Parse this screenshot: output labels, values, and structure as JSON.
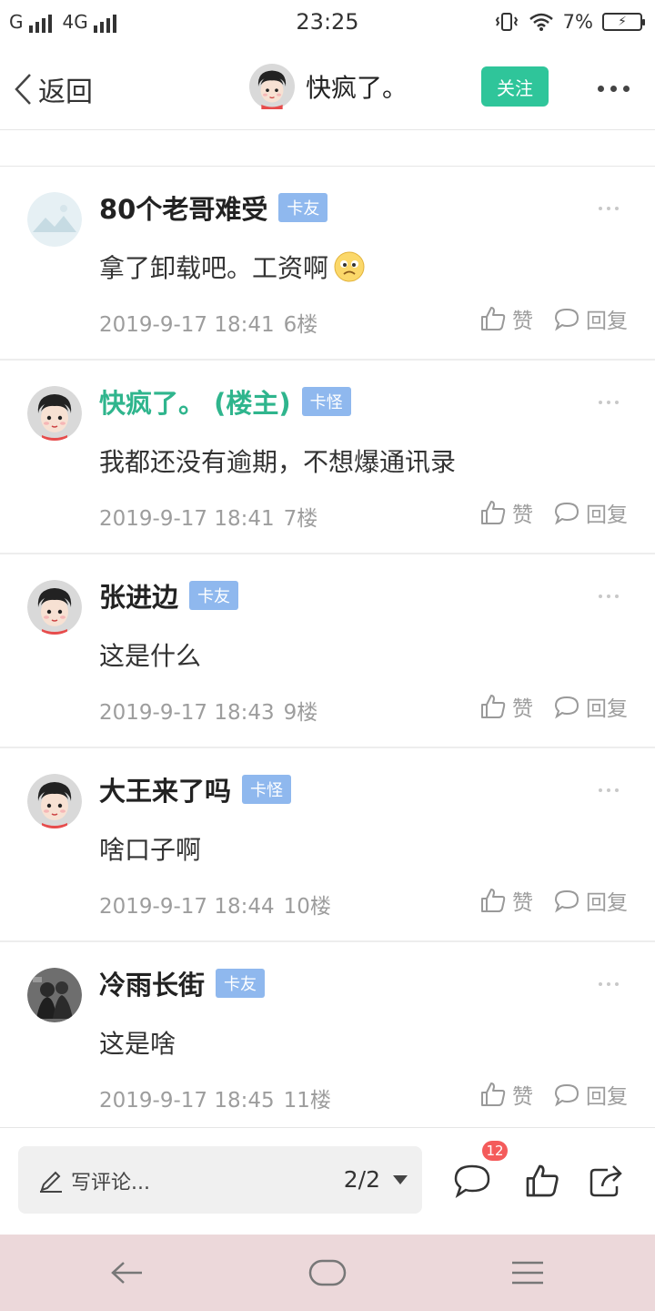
{
  "status_bar": {
    "carrier1": "G",
    "carrier2": "4G",
    "time": "23:25",
    "battery_percent": "7%"
  },
  "header": {
    "back_label": "返回",
    "username": "快疯了。",
    "follow_label": "关注"
  },
  "comments": [
    {
      "username": "80个老哥难受",
      "tag": "卡友",
      "text": "拿了卸载吧。工资啊",
      "emoji": "sad-face-icon",
      "date": "2019-9-17 18:41",
      "floor": "6楼",
      "like_label": "赞",
      "reply_label": "回复"
    },
    {
      "username": "快疯了。 (楼主)",
      "tag": "卡怪",
      "text": "我都还没有逾期，不想爆通讯录",
      "date": "2019-9-17 18:41",
      "floor": "7楼",
      "like_label": "赞",
      "reply_label": "回复"
    },
    {
      "username": "张进边",
      "tag": "卡友",
      "text": "这是什么",
      "date": "2019-9-17 18:43",
      "floor": "9楼",
      "like_label": "赞",
      "reply_label": "回复"
    },
    {
      "username": "大王来了吗",
      "tag": "卡怪",
      "text": "啥口子啊",
      "date": "2019-9-17 18:44",
      "floor": "10楼",
      "like_label": "赞",
      "reply_label": "回复"
    },
    {
      "username": "冷雨长街",
      "tag": "卡友",
      "text": "这是啥",
      "date": "2019-9-17 18:45",
      "floor": "11楼",
      "like_label": "赞",
      "reply_label": "回复"
    }
  ],
  "bottom_bar": {
    "comment_placeholder": "写评论...",
    "page_indicator": "2/2",
    "comment_count_badge": "12"
  },
  "colors": {
    "accent_green": "#2fc59a",
    "tag_blue": "#8fb8ee",
    "badge_red": "#f45b5b",
    "nav_bar_bg": "#ecd8da"
  }
}
